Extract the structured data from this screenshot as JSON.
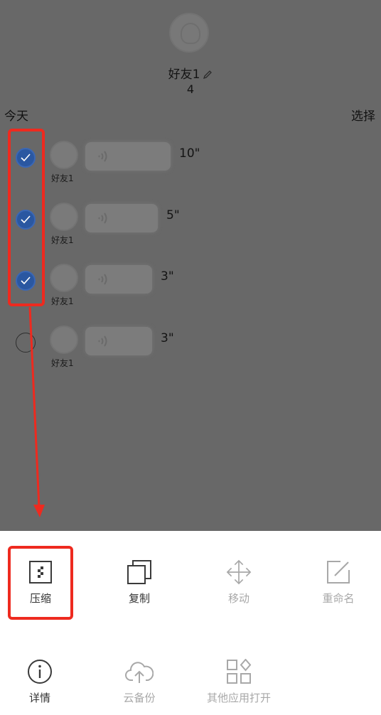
{
  "header": {
    "contact_name": "好友1",
    "count": "4"
  },
  "toolbar": {
    "today_label": "今天",
    "select_label": "选择"
  },
  "messages": [
    {
      "sender": "好友1",
      "duration": "10\"",
      "selected": true
    },
    {
      "sender": "好友1",
      "duration": "5\"",
      "selected": true
    },
    {
      "sender": "好友1",
      "duration": "3\"",
      "selected": true
    },
    {
      "sender": "好友1",
      "duration": "3\"",
      "selected": false
    }
  ],
  "actions": [
    {
      "label": "压缩",
      "icon": "compress-icon",
      "enabled": true
    },
    {
      "label": "复制",
      "icon": "copy-icon",
      "enabled": true
    },
    {
      "label": "移动",
      "icon": "move-icon",
      "enabled": false
    },
    {
      "label": "重命名",
      "icon": "rename-icon",
      "enabled": false
    },
    {
      "label": "详情",
      "icon": "info-icon",
      "enabled": true
    },
    {
      "label": "云备份",
      "icon": "cloud-upload-icon",
      "enabled": false
    },
    {
      "label": "其他应用打开",
      "icon": "open-with-icon",
      "enabled": false
    }
  ],
  "colors": {
    "overlay": "#686868",
    "check_selected": "#2a57a1",
    "annotation_red": "#ee2a1f",
    "sheet_background": "#ffffff"
  }
}
